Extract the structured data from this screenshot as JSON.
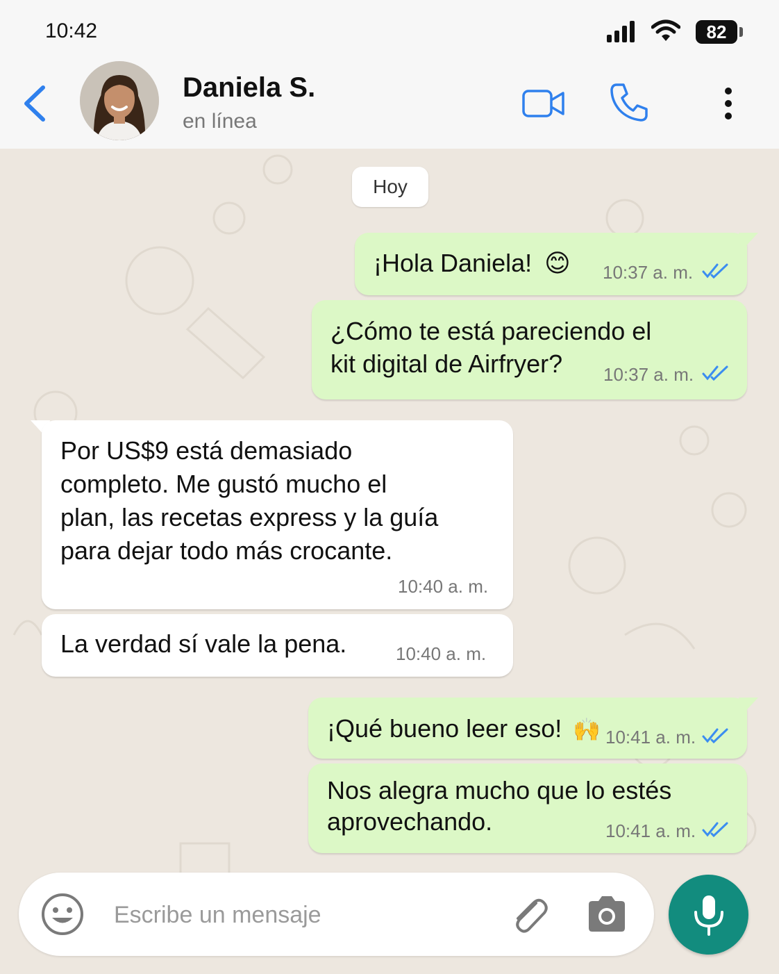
{
  "status_bar": {
    "time": "10:42",
    "battery": "82",
    "icons": [
      "signal-icon",
      "wifi-icon",
      "battery-icon"
    ]
  },
  "header": {
    "contact_name": "Daniela S.",
    "presence": "en línea",
    "icons": [
      "back-chevron-icon",
      "video-call-icon",
      "phone-call-icon",
      "more-vertical-icon"
    ]
  },
  "chat": {
    "day_label": "Hoy",
    "messages": [
      {
        "dir": "out",
        "text_lines": [
          "¡Hola Daniela!"
        ],
        "emoji": "😊",
        "time": "10:37 a. m.",
        "read": true
      },
      {
        "dir": "out",
        "text_lines": [
          "¿Cómo te está pareciendo el",
          "kit digital de Airfryer?"
        ],
        "time": "10:37 a. m.",
        "read": true
      },
      {
        "dir": "in",
        "text_lines": [
          "Por US$9 está demasiado",
          "completo. Me gustó mucho el",
          "plan, las recetas express y la guía",
          "para dejar todo más crocante."
        ],
        "time": "10:40 a. m."
      },
      {
        "dir": "in",
        "text_lines": [
          "La verdad sí vale la pena."
        ],
        "time": "10:40 a. m."
      },
      {
        "dir": "out",
        "text_lines": [
          "¡Qué bueno leer eso!"
        ],
        "emoji": "🙌",
        "time": "10:41 a. m.",
        "read": true
      },
      {
        "dir": "out",
        "text_lines": [
          "Nos alegra mucho que lo estés",
          "aprovechando."
        ],
        "time": "10:41 a. m.",
        "read": true
      }
    ]
  },
  "composer": {
    "placeholder": "Escribe un mensaje",
    "icons": [
      "emoji-icon",
      "attach-icon",
      "camera-icon",
      "mic-icon"
    ]
  },
  "colors": {
    "accent": "#2f80ed",
    "outgoing_bubble": "#dcf8c6",
    "incoming_bubble": "#ffffff",
    "chat_background": "#ede7df",
    "mic_button": "#128c7e",
    "read_ticks": "#3b8df0"
  }
}
